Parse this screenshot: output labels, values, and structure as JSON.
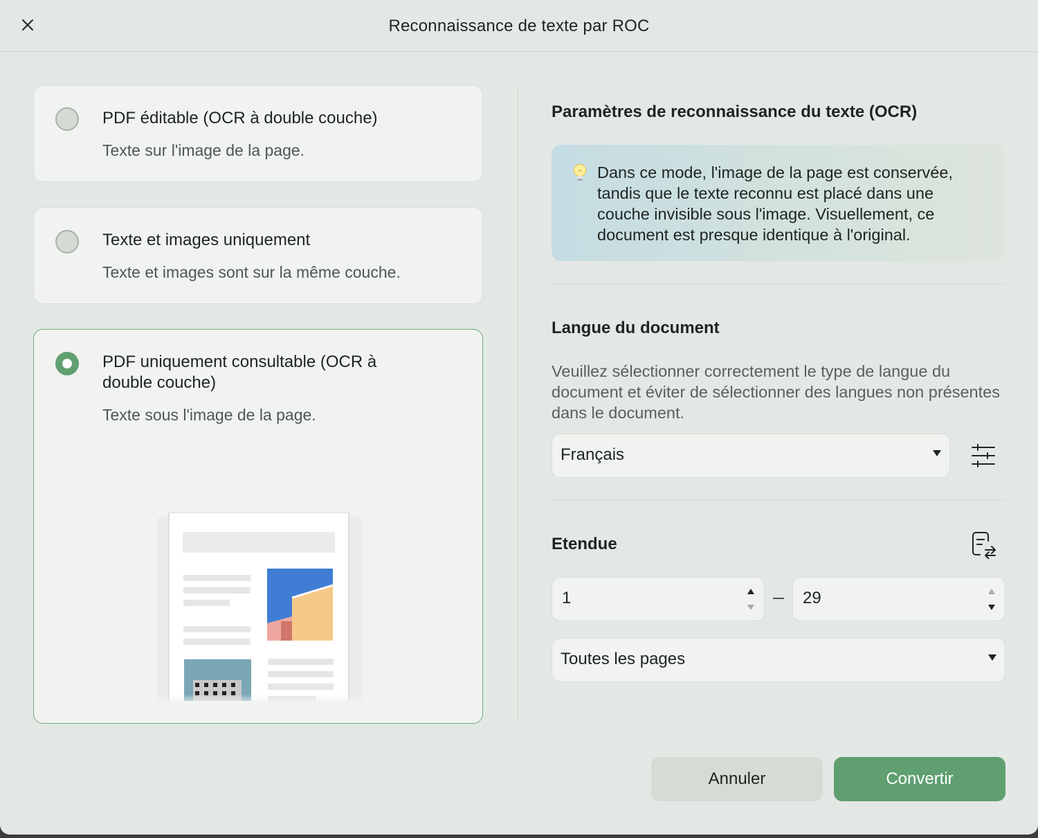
{
  "dialog": {
    "title": "Reconnaissance de texte par ROC"
  },
  "modes": [
    {
      "title": "PDF éditable (OCR à double couche)",
      "description": "Texte sur l'image de la page.",
      "selected": false
    },
    {
      "title": "Texte et images uniquement",
      "description": "Texte et images sont sur la même couche.",
      "selected": false
    },
    {
      "title": "PDF uniquement consultable (OCR à double couche)",
      "description": "Texte sous l'image de la page.",
      "selected": true
    }
  ],
  "settings": {
    "title": "Paramètres de reconnaissance du texte (OCR)",
    "tip": "Dans ce mode, l'image de la page est conservée, tandis que le texte reconnu est placé dans une couche invisible sous l'image. Visuellement, ce document est presque identique à l'original."
  },
  "language": {
    "title": "Langue du document",
    "help": "Veuillez sélectionner correctement le type de langue du document et éviter de sélectionner des langues non présentes dans le document.",
    "selected": "Français"
  },
  "range": {
    "title": "Etendue",
    "from": "1",
    "to": "29",
    "scope": "Toutes les pages"
  },
  "actions": {
    "cancel": "Annuler",
    "convert": "Convertir"
  },
  "colors": {
    "accent": "#5f9f70",
    "background": "#e4e8e4",
    "card": "#f1f3f0"
  },
  "icons": {
    "close": "close-icon",
    "tip": "lightbulb-icon",
    "language_settings": "sliders-icon",
    "range_swap": "page-swap-icon"
  }
}
